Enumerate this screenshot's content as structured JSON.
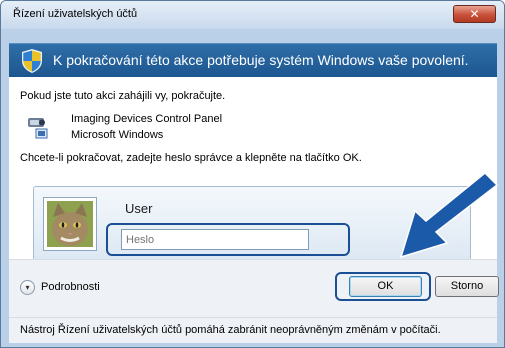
{
  "window": {
    "title": "Řízení uživatelských účtů",
    "close_glyph": "✕",
    "close_icon": "close-icon"
  },
  "banner": {
    "icon": "uac-shield-icon",
    "text": "K pokračování této akce potřebuje systém Windows vaše povolení."
  },
  "content": {
    "intro": "Pokud jste tuto akci zahájili vy, pokračujte.",
    "program": {
      "icon": "imaging-devices-icon",
      "name": "Imaging Devices Control Panel",
      "publisher": "Microsoft Windows"
    },
    "instruction": "Chcete-li pokračovat, zadejte heslo správce a klepněte na tlačítko OK."
  },
  "credential": {
    "avatar_icon": "user-avatar-icon",
    "user_name": "User",
    "password_placeholder": "Heslo",
    "highlight_color": "#1b4f95"
  },
  "callout": {
    "arrow_color": "#1b5aa8",
    "icon": "pointer-arrow-icon"
  },
  "actions": {
    "details_label": "Podrobnosti",
    "details_icon": "chevron-down-icon",
    "ok_label": "OK",
    "cancel_label": "Storno"
  },
  "footer": {
    "text": "Nástroj Řízení uživatelských účtů pomáhá zabránit neoprávněným změnám v počítači."
  }
}
